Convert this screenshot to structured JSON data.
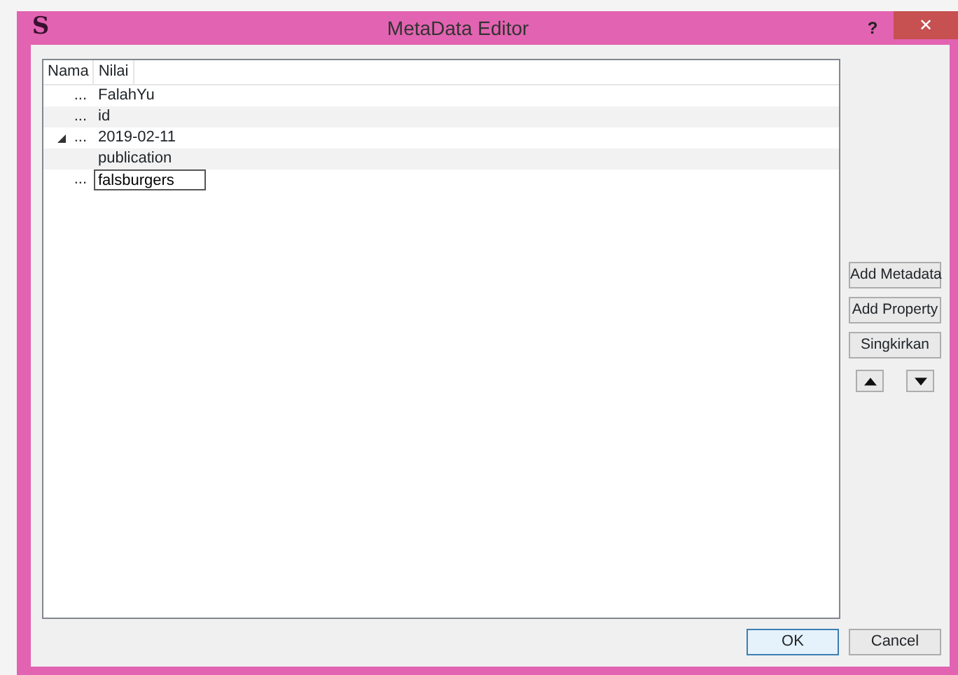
{
  "window": {
    "title": "MetaData Editor",
    "logo": "S",
    "help": "?",
    "close": "✕"
  },
  "tree": {
    "columns": [
      "Nama",
      "Nilai"
    ],
    "rows": [
      {
        "name": "...",
        "value": "FalahYu"
      },
      {
        "name": "...",
        "value": "id"
      },
      {
        "name": "...",
        "value": "2019-02-11",
        "expanded": true,
        "children": [
          {
            "value": "publication"
          }
        ]
      },
      {
        "name": "...",
        "value": "falsburgers",
        "editing": true
      }
    ]
  },
  "side_buttons": [
    {
      "kind": "text",
      "label": "Add Metadata"
    },
    {
      "kind": "text",
      "label": "Add Property"
    },
    {
      "kind": "text",
      "label": "Singkirkan"
    }
  ],
  "move_buttons": [
    {
      "kind": "up"
    },
    {
      "kind": "down"
    }
  ],
  "buttons": [
    {
      "label": "OK",
      "default": true
    },
    {
      "label": "Cancel",
      "default": false
    }
  ]
}
